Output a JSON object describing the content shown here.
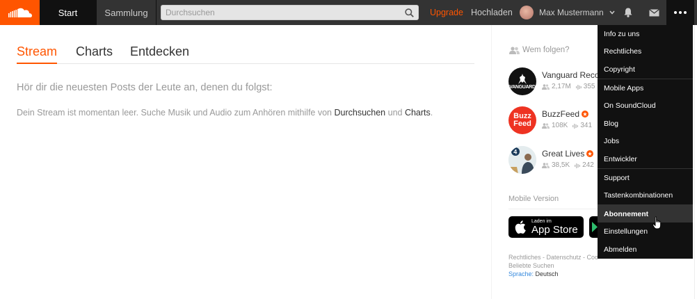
{
  "header": {
    "logo_icon": "soundcloud-logo-icon",
    "tabs": [
      {
        "label": "Start",
        "active": true
      },
      {
        "label": "Sammlung",
        "active": false
      }
    ],
    "search": {
      "placeholder": "Durchsuchen",
      "value": ""
    },
    "upgrade_label": "Upgrade",
    "upload_label": "Hochladen",
    "user_name": "Max Mustermann",
    "accent_color": "#ff5500"
  },
  "main": {
    "tabs": [
      {
        "label": "Stream",
        "active": true
      },
      {
        "label": "Charts",
        "active": false
      },
      {
        "label": "Entdecken",
        "active": false
      }
    ],
    "lead": "Hör dir die neuesten Posts der Leute an, denen du folgst:",
    "empty_prefix": "Dein Stream ist momentan leer. Suche Musik und Audio zum Anhören mithilfe von ",
    "empty_link1": "Durchsuchen",
    "empty_mid": " und ",
    "empty_link2": "Charts",
    "empty_suffix": "."
  },
  "sidebar": {
    "who_to_follow": "Wem folgen?",
    "follow": [
      {
        "name": "Vanguard Records",
        "followers": "2,17M",
        "tracks": "355",
        "pro": false,
        "pic_text": "VANGUARD"
      },
      {
        "name": "BuzzFeed",
        "followers": "108K",
        "tracks": "341",
        "pro": true,
        "pic_text1": "Buzz",
        "pic_text2": "Feed"
      },
      {
        "name": "Great Lives",
        "followers": "38,5K",
        "tracks": "242",
        "pro": true
      }
    ],
    "mobile_version": "Mobile Version",
    "appstore_small": "Laden im",
    "appstore_big": "App Store",
    "footer_links": "Rechtliches - Datenschutz - Cookies",
    "footer_popular": "Beliebte Suchen",
    "footer_language_label": "Sprache:",
    "footer_language_value": "Deutsch"
  },
  "dropdown": {
    "items": [
      "Info zu uns",
      "Rechtliches",
      "Copyright",
      "Mobile Apps",
      "On SoundCloud",
      "Blog",
      "Jobs",
      "Entwickler",
      "Support",
      "Tastenkombinationen",
      "Abonnement",
      "Einstellungen",
      "Abmelden"
    ],
    "hovered": "Abonnement"
  }
}
